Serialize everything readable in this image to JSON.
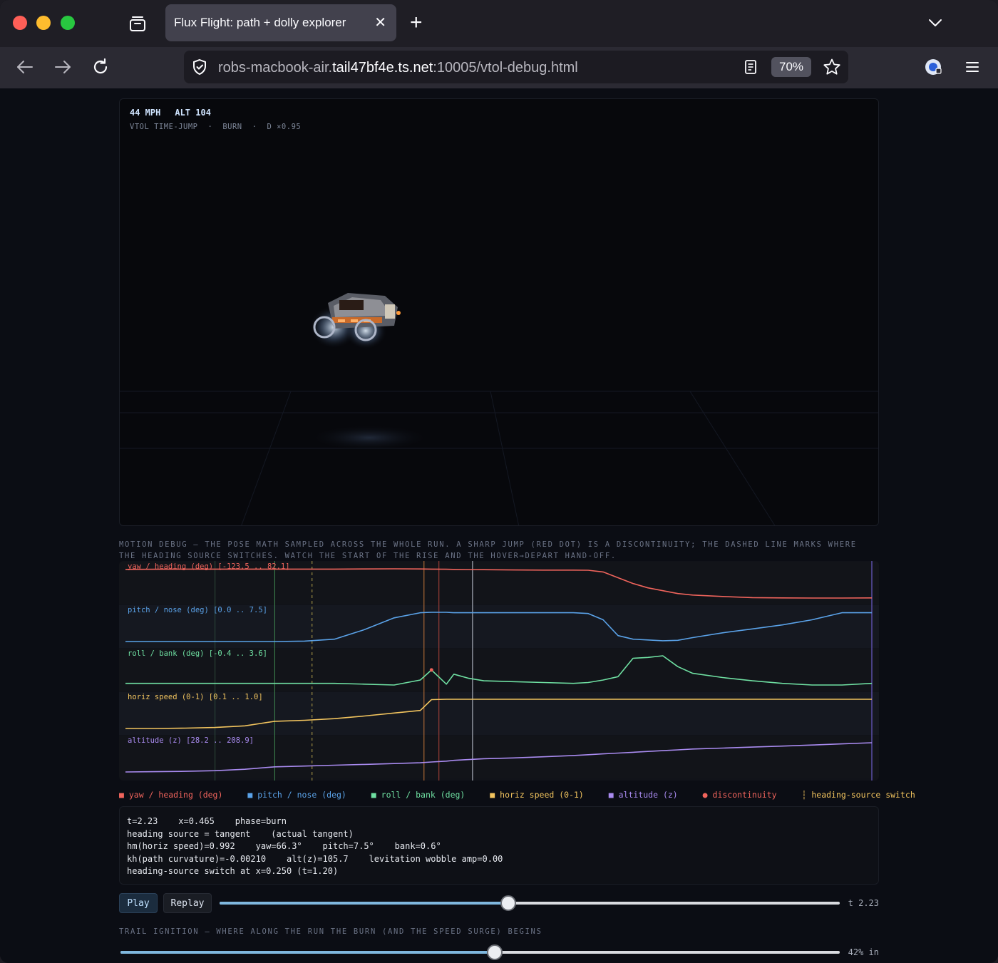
{
  "browser": {
    "tab_title": "Flux Flight: path + dolly explorer",
    "url_prefix": "robs-macbook-air.",
    "url_host": "tail47bf4e.ts.net",
    "url_path": ":10005/vtol-debug.html",
    "zoom": "70%"
  },
  "hud": {
    "speed": "44 MPH",
    "altitude": "ALT 104",
    "mode": "VTOL TIME-JUMP",
    "sep": "·",
    "phase": "BURN",
    "dolly": "D ×0.95"
  },
  "motion_caption": "MOTION DEBUG — THE POSE MATH SAMPLED ACROSS THE WHOLE RUN. A SHARP JUMP (RED DOT) IS A DISCONTINUITY; THE DASHED LINE MARKS WHERE THE HEADING SOURCE SWITCHES. WATCH THE START OF THE RISE AND THE HOVER→DEPART HAND-OFF.",
  "chart_data": {
    "type": "line",
    "x": [
      0.0,
      0.04,
      0.08,
      0.12,
      0.16,
      0.2,
      0.24,
      0.28,
      0.32,
      0.36,
      0.395,
      0.41,
      0.43,
      0.44,
      0.46,
      0.48,
      0.52,
      0.56,
      0.6,
      0.62,
      0.64,
      0.66,
      0.68,
      0.7,
      0.72,
      0.74,
      0.76,
      0.8,
      0.84,
      0.88,
      0.92,
      0.96,
      1.0
    ],
    "series": [
      {
        "name": "yaw / heading (deg)",
        "range": "[-123.5 .. 82.1]",
        "color": "#f0645c",
        "values": [
          78,
          79,
          80,
          80,
          80,
          80,
          80,
          80,
          81,
          82,
          81,
          80,
          79,
          78,
          77,
          76,
          74,
          73,
          73,
          72,
          60,
          20,
          -20,
          -50,
          -70,
          -90,
          -100,
          -110,
          -118,
          -120,
          -121,
          -121,
          -120
        ]
      },
      {
        "name": "pitch / nose (deg)",
        "range": "[0.0 .. 7.5]",
        "color": "#5aa2e8",
        "values": [
          0,
          0,
          0,
          0,
          0,
          0,
          0.1,
          0.6,
          3.0,
          6.0,
          7.3,
          7.4,
          7.4,
          7.3,
          7.3,
          7.3,
          7.3,
          7.3,
          7.3,
          7.1,
          5.5,
          1.5,
          0.6,
          0.4,
          0.2,
          0.3,
          1.0,
          2.2,
          3.2,
          4.2,
          5.5,
          7.3,
          7.3
        ]
      },
      {
        "name": "roll / bank (deg)",
        "range": "[-0.4 .. 3.6]",
        "color": "#6fe0a2",
        "values": [
          0,
          0,
          0,
          0,
          0,
          0,
          0,
          0,
          -0.1,
          -0.2,
          0.4,
          1.6,
          -0.1,
          1.1,
          0.6,
          0.3,
          0.2,
          0.1,
          0.0,
          0.1,
          0.4,
          0.8,
          3.0,
          3.1,
          3.3,
          2.0,
          1.2,
          0.7,
          0.3,
          0.0,
          -0.2,
          -0.2,
          0.0
        ]
      },
      {
        "name": "horiz speed (0-1)",
        "range": "[0.1 .. 1.0]",
        "color": "#f2c45e",
        "values": [
          0.1,
          0.1,
          0.11,
          0.13,
          0.18,
          0.32,
          0.35,
          0.4,
          0.48,
          0.57,
          0.65,
          0.98,
          0.99,
          0.99,
          0.99,
          0.99,
          0.99,
          0.99,
          0.99,
          0.99,
          0.99,
          0.99,
          0.99,
          0.99,
          0.99,
          0.99,
          0.99,
          0.99,
          0.99,
          0.99,
          0.99,
          0.99,
          0.99
        ]
      },
      {
        "name": "altitude (z)",
        "range": "[28.2 .. 208.9]",
        "color": "#a98bf0",
        "values": [
          28.2,
          30,
          32,
          36,
          45,
          60,
          65,
          70,
          75,
          80,
          85,
          90,
          95,
          100,
          105,
          110,
          115,
          122,
          130,
          135,
          140,
          145,
          150,
          155,
          160,
          165,
          170,
          176,
          182,
          188,
          195,
          202,
          208.9
        ]
      }
    ],
    "discontinuity_label": "discontinuity",
    "switch_label": "heading-source switch",
    "legend": [
      "yaw / heading (deg)",
      "pitch / nose (deg)",
      "roll / bank (deg)",
      "horiz speed (0-1)",
      "altitude (z)"
    ],
    "markers": {
      "cursor": 0.465,
      "switch": 0.25,
      "discontinuity": 0.4
    }
  },
  "readout": {
    "line1": "t=2.23    x=0.465    phase=burn",
    "line2": "heading source = tangent    (actual tangent)",
    "line3": "hm(horiz speed)=0.992    yaw=66.3°    pitch=7.5°    bank=0.6°",
    "line4": "kh(path curvature)=-0.00210    alt(z)=105.7    levitation wobble amp=0.00",
    "line5": "heading-source switch at x=0.250 (t=1.20)"
  },
  "controls": {
    "play_label": "Play",
    "replay_label": "Replay",
    "time_label": "t 2.23",
    "time_value": 0.465,
    "ignition_caption": "TRAIL IGNITION — WHERE ALONG THE RUN THE BURN (AND THE SPEED SURGE) BEGINS",
    "ignition_label": "42% in",
    "ignition_value": 0.52
  }
}
